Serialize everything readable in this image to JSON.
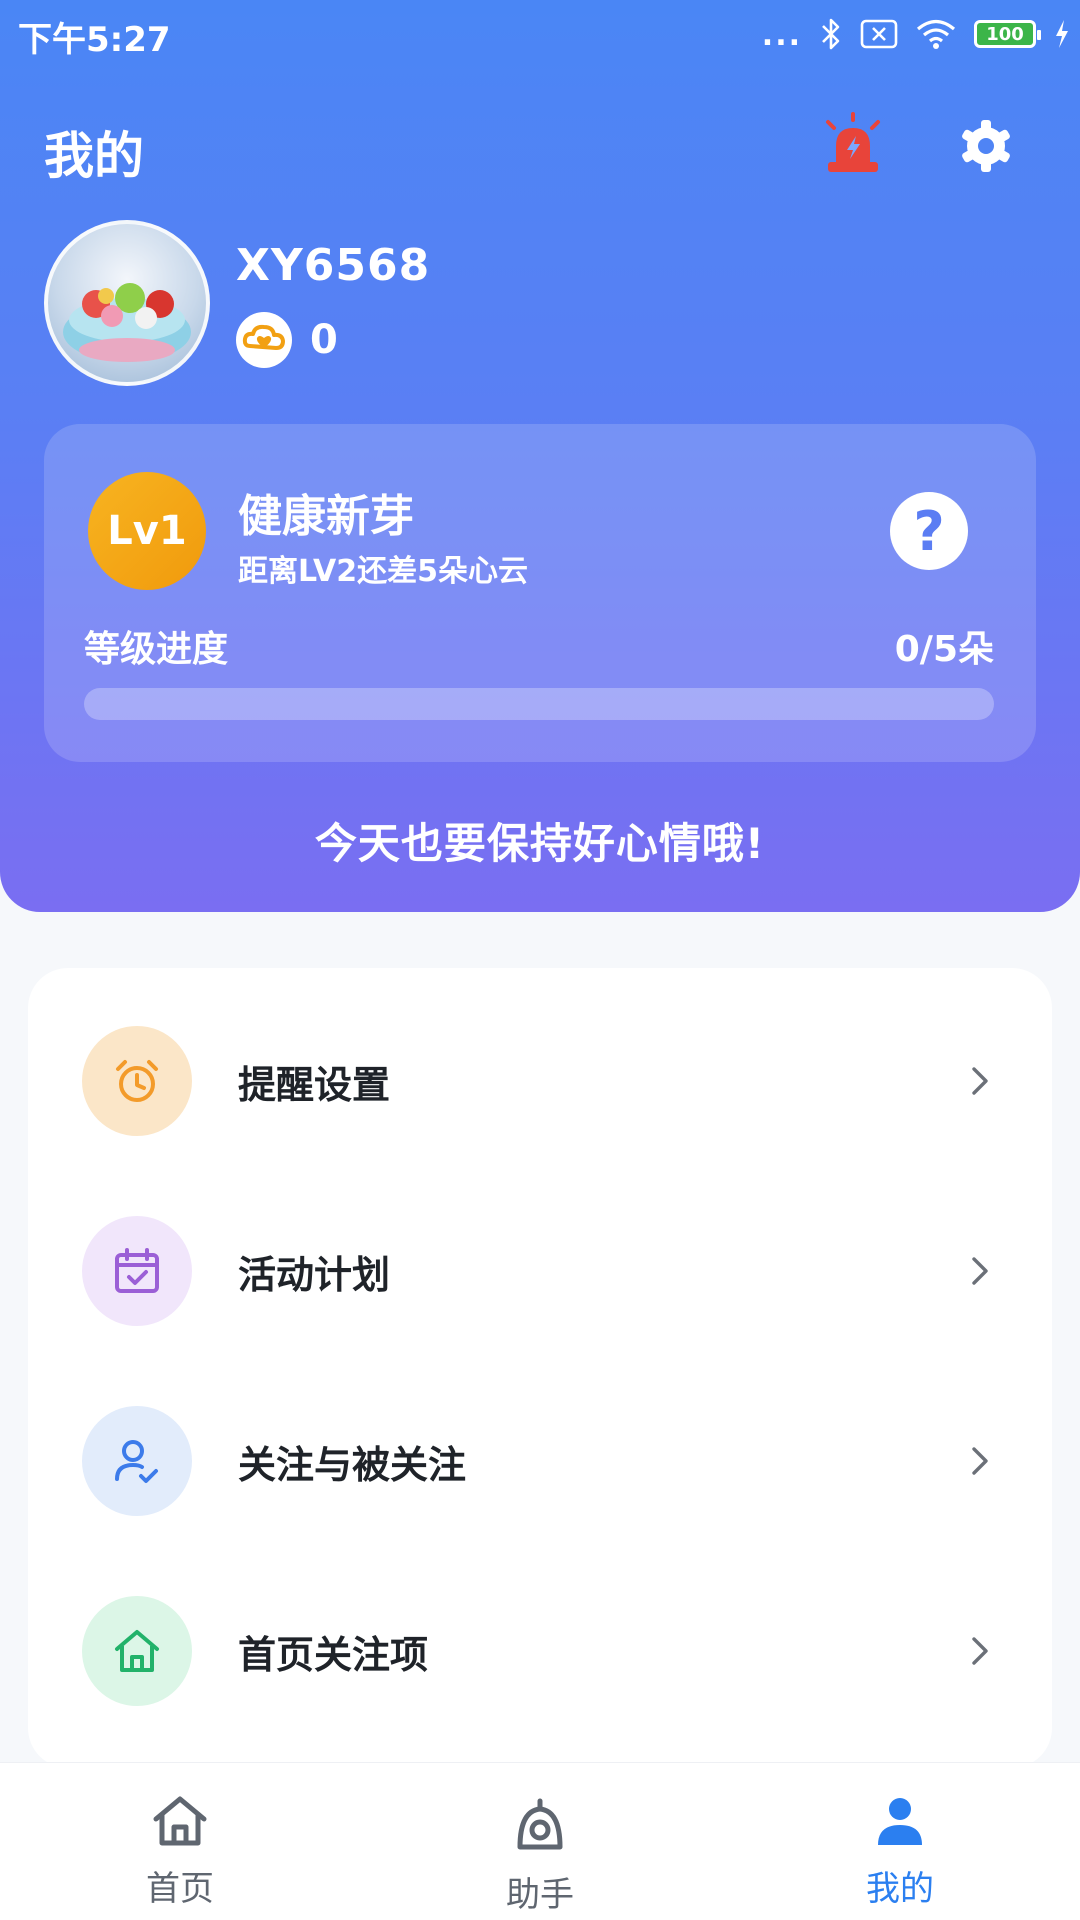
{
  "status_bar": {
    "time": "下午5:27",
    "dots": "...",
    "battery": "100"
  },
  "header": {
    "title": "我的",
    "alarm_icon": "alarm-light-icon",
    "settings_icon": "gear-icon"
  },
  "profile": {
    "username": "XY6568",
    "coin_icon": "heart-cloud-coin-icon",
    "coin_count": "0"
  },
  "level": {
    "badge": "Lv1",
    "name": "健康新芽",
    "description": "距离LV2还差5朵心云",
    "help_symbol": "?",
    "progress_label": "等级进度",
    "progress_value": "0/5朵",
    "progress_fraction": 0
  },
  "motto": "今天也要保持好心情哦!",
  "menu": [
    {
      "label": "提醒设置",
      "icon": "alarm-clock-icon",
      "icon_color": "#f39b2a",
      "bg_color": "#fbe6c8"
    },
    {
      "label": "活动计划",
      "icon": "calendar-check-icon",
      "icon_color": "#9b5fd6",
      "bg_color": "#f1e6fb"
    },
    {
      "label": "关注与被关注",
      "icon": "user-follow-icon",
      "icon_color": "#3c7bea",
      "bg_color": "#e2ecfb"
    },
    {
      "label": "首页关注项",
      "icon": "home-icon",
      "icon_color": "#22b26a",
      "bg_color": "#dcf6e7"
    }
  ],
  "bottom_nav": [
    {
      "label": "首页",
      "icon": "home-nav-icon",
      "active": false
    },
    {
      "label": "助手",
      "icon": "assistant-camera-icon",
      "active": false
    },
    {
      "label": "我的",
      "icon": "person-icon",
      "active": true
    }
  ],
  "colors": {
    "accent": "#2b7ff0",
    "header_top": "#4a86f5",
    "header_bottom": "#7a6ef2"
  }
}
